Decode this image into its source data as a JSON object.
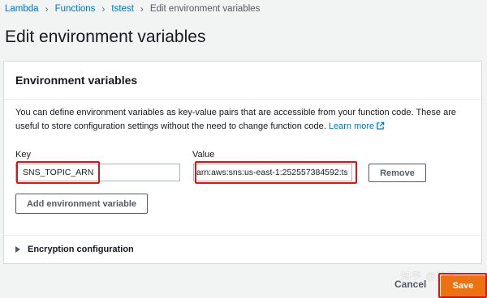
{
  "breadcrumb": {
    "items": [
      "Lambda",
      "Functions",
      "tstest"
    ],
    "current": "Edit environment variables"
  },
  "page": {
    "title": "Edit environment variables"
  },
  "panel": {
    "title": "Environment variables",
    "description": "You can define environment variables as key-value pairs that are accessible from your function code. These are useful to store configuration settings without the need to change function code.",
    "learn_more": "Learn more"
  },
  "env": {
    "key_label": "Key",
    "value_label": "Value",
    "rows": [
      {
        "key": "SNS_TOPIC_ARN",
        "value": "arn:aws:sns:us-east-1:252557384592:ts"
      }
    ],
    "remove_label": "Remove",
    "add_label": "Add environment variable"
  },
  "encryption": {
    "label": "Encryption configuration"
  },
  "footer": {
    "cancel_label": "Cancel",
    "save_label": "Save",
    "watermark": "知乎 @拉面"
  },
  "colors": {
    "link": "#0073bb",
    "primary": "#ec7211",
    "highlight": "#d0191d"
  }
}
